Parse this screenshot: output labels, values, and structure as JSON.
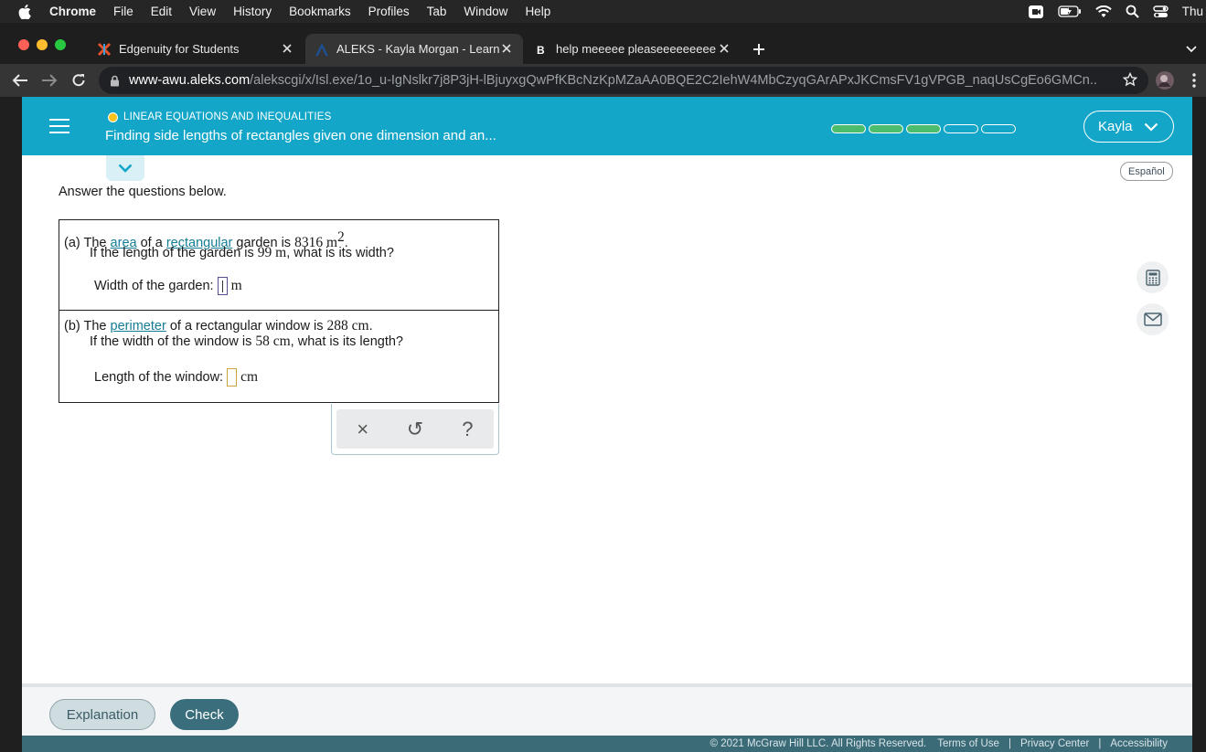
{
  "menubar": {
    "app_name": "Chrome",
    "items": [
      "File",
      "Edit",
      "View",
      "History",
      "Bookmarks",
      "Profiles",
      "Tab",
      "Window",
      "Help"
    ],
    "clock": "Thu"
  },
  "tabs": [
    {
      "title": "Edgenuity for Students",
      "icon": "edgenuity-icon"
    },
    {
      "title": "ALEKS - Kayla Morgan - Learn",
      "icon": "aleks-icon"
    },
    {
      "title": "help meeeee pleaseeeeeeeee",
      "icon": "brainly-icon"
    }
  ],
  "address": {
    "host": "www-awu.aleks.com",
    "path": "/alekscgi/x/Isl.exe/1o_u-IgNslkr7j8P3jH-lBjuyxgQwPfKBcNzKpMZaAA0BQE2C2IehW4MbCzyqGArAPxJKCmsFV1gVPGB_naqUsCgEo6GMCn..."
  },
  "header": {
    "topic_label": "LINEAR EQUATIONS AND INEQUALITIES",
    "topic_title": "Finding side lengths of rectangles given one dimension and an...",
    "progress_total": 5,
    "progress_done": 3,
    "user_name": "Kayla"
  },
  "language_button": "Español",
  "instructions": "Answer the questions below.",
  "question_a": {
    "prefix": "(a)",
    "t1": "The",
    "link1": "area",
    "t2": "of a",
    "link2": "rectangular",
    "t3": "garden is",
    "value": "8316 m",
    "sup": "2",
    "t4": ".",
    "line2_t1": "If the length of the garden is",
    "line2_value": "99 m",
    "line2_t2": ", what is its width?",
    "answer_label": "Width of the garden:",
    "unit": "m"
  },
  "question_b": {
    "prefix": "(b)",
    "t1": "The",
    "link1": "perimeter",
    "t2": "of a rectangular window is",
    "value": "288 cm",
    "t3": ".",
    "line2_t1": "If the width of the window is",
    "line2_value": "58 cm",
    "line2_t2": ", what is its length?",
    "answer_label": "Length of the window:",
    "unit": "cm"
  },
  "toolpad": {
    "clear": "×",
    "undo": "↺",
    "help": "?"
  },
  "footer": {
    "explanation": "Explanation",
    "check": "Check",
    "copyright": "© 2021 McGraw Hill LLC. All Rights Reserved.",
    "terms": "Terms of Use",
    "privacy": "Privacy Center",
    "accessibility": "Accessibility",
    "separator": "|"
  },
  "colors": {
    "header": "#13a6c8",
    "progress_done": "#4cbd6c",
    "check_button": "#3a6e7c",
    "link": "#147c94"
  }
}
